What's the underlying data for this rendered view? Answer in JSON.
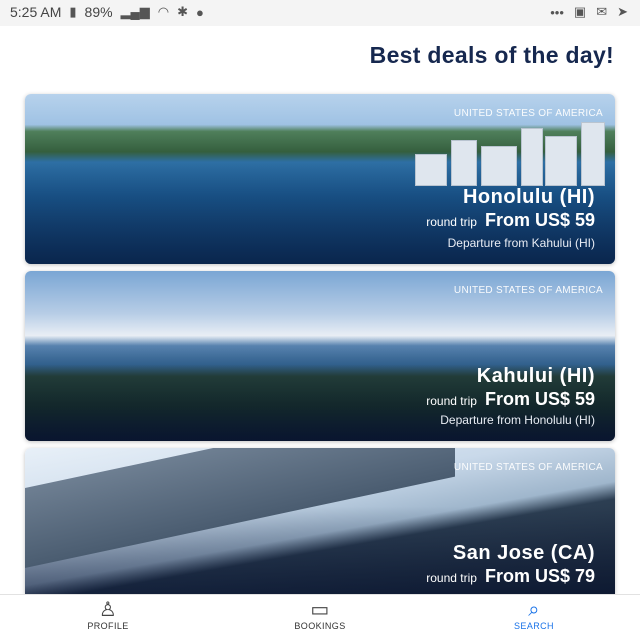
{
  "status": {
    "time": "5:25 AM",
    "battery": "89%"
  },
  "heading": "Best deals of the day!",
  "deals": [
    {
      "country": "UNITED STATES OF AMERICA",
      "city": "Honolulu (HI)",
      "price": "From US$ 59",
      "trip": "round trip",
      "departure": "Departure from Kahului (HI)"
    },
    {
      "country": "UNITED STATES OF AMERICA",
      "city": "Kahului (HI)",
      "price": "From US$ 59",
      "trip": "round trip",
      "departure": "Departure from Honolulu (HI)"
    },
    {
      "country": "UNITED STATES OF AMERICA",
      "city": "San Jose (CA)",
      "price": "From US$ 79",
      "trip": "round trip"
    }
  ],
  "nav": {
    "search": "SEARCH",
    "bookings": "BOOKINGS",
    "profile": "PROFILE"
  },
  "colors": {
    "heading": "#16284f",
    "active_nav": "#1a73e8"
  }
}
